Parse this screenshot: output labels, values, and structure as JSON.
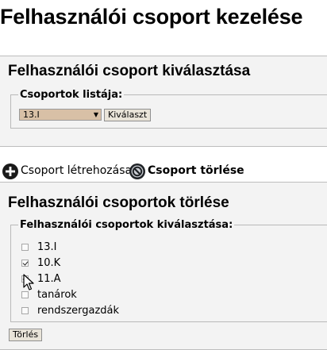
{
  "page": {
    "title": "Felhasználói csoport kezelése"
  },
  "select_panel": {
    "title": "Felhasználói csoport kiválasztása",
    "legend": "Csoportok listája:",
    "selected_group": "13.I",
    "select_button": "Kiválaszt"
  },
  "actions": {
    "create_label": "Csoport létrehozása",
    "delete_label": "Csoport törlése"
  },
  "delete_panel": {
    "title": "Felhasználói csoportok törlése",
    "legend": "Felhasználói csoportok kiválasztása:",
    "groups": [
      {
        "label": "13.I",
        "checked": false
      },
      {
        "label": "10.K",
        "checked": true
      },
      {
        "label": "11.A",
        "checked": true
      },
      {
        "label": "tanárok",
        "checked": false
      },
      {
        "label": "rendszergazdák",
        "checked": false
      }
    ],
    "delete_button": "Törlés"
  },
  "icons": {
    "create": "plus-circle-icon",
    "delete": "no-entry-icon"
  },
  "colors": {
    "panel_bg": "#f3f3f3",
    "select_bg": "#d8c0a6",
    "button_bg": "#e9e4d9"
  }
}
